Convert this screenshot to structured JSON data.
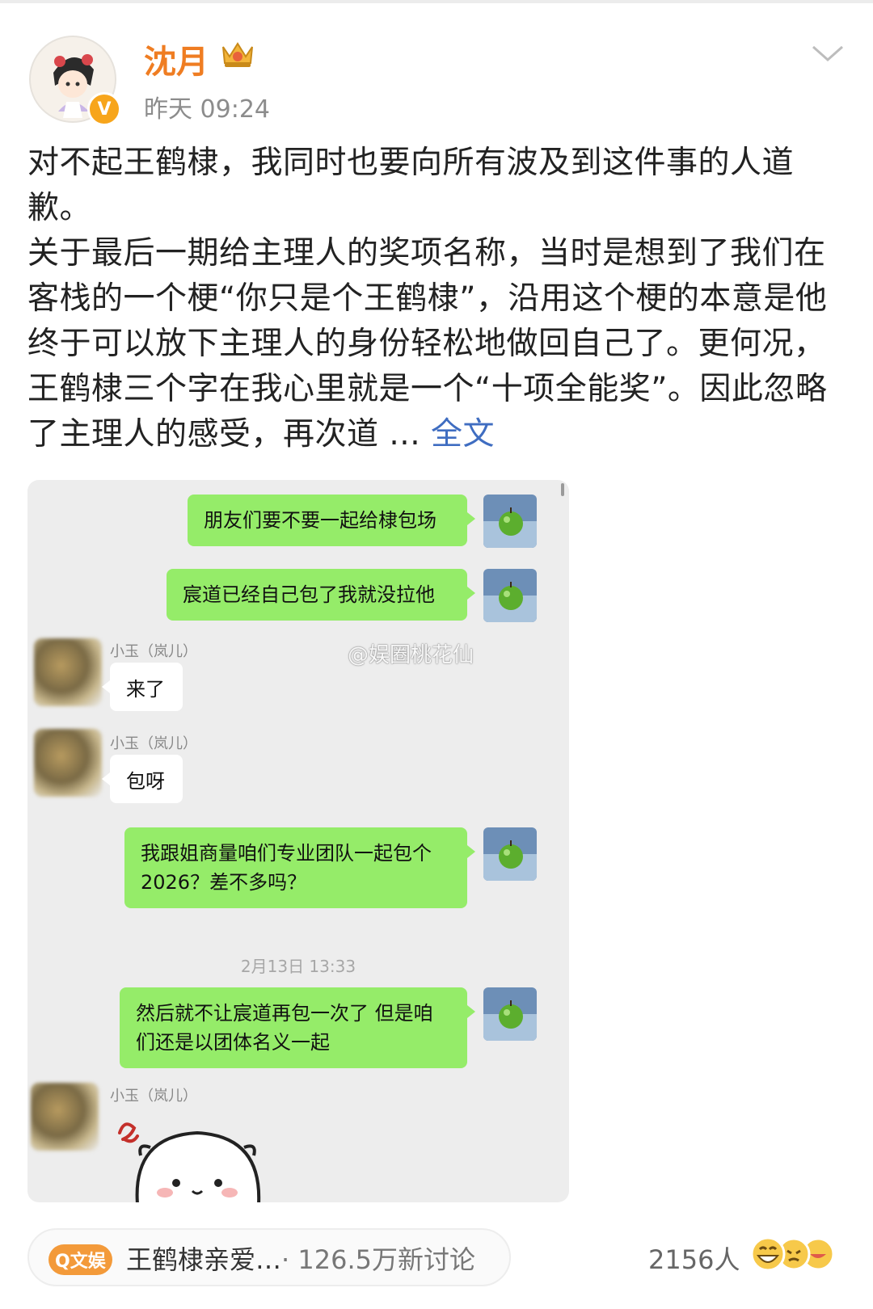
{
  "post": {
    "username": "沈月",
    "time": "昨天 09:24",
    "badge_icon": "verified-v-icon",
    "level_icon": "crown-level-icon",
    "paragraph1": "对不起王鹤棣，我同时也要向所有波及到这件事的人道歉。",
    "paragraph2": "关于最后一期给主理人的奖项名称，当时是想到了我们在客栈的一个梗“你只是个王鹤棣”，沿用这个梗的本意是他终于可以放下主理人的身份轻松地做回自己了。更何况，王鹤棣三个字在我心里就是一个“十项全能奖”。因此忽略了主理人的感受，再次道 ...",
    "full_text_link": "全文"
  },
  "chat": {
    "watermark": "@娱圈桃花仙",
    "messages": [
      {
        "text": "朋友们要不要一起给棣包场"
      },
      {
        "text": "宸道已经自己包了我就没拉他"
      },
      {
        "sender": "小玉（岚儿）",
        "text": "来了"
      },
      {
        "sender": "小玉（岚儿）",
        "text": "包呀"
      },
      {
        "line1": "我跟姐商量咱们专业团队一起包个",
        "line2": "2026？差不多吗？"
      },
      {
        "line1": "然后就不让宸道再包一次了 但是咱",
        "line2": "们还是以团体名义一起"
      },
      {
        "sender": "小玉（岚儿）"
      }
    ],
    "timestamp": "2月13日 13:33"
  },
  "footer": {
    "topic_tag": "Q文娱",
    "topic": "王鹤棣亲爱…",
    "discussion": "· 126.5万新讨论",
    "likes_count": "2156人"
  },
  "colors": {
    "username": "#ef7d22",
    "link": "#3f6dc1",
    "bubble_green": "#95ec69",
    "chat_bg": "#ededed",
    "tag_orange": "#f39a3a"
  }
}
